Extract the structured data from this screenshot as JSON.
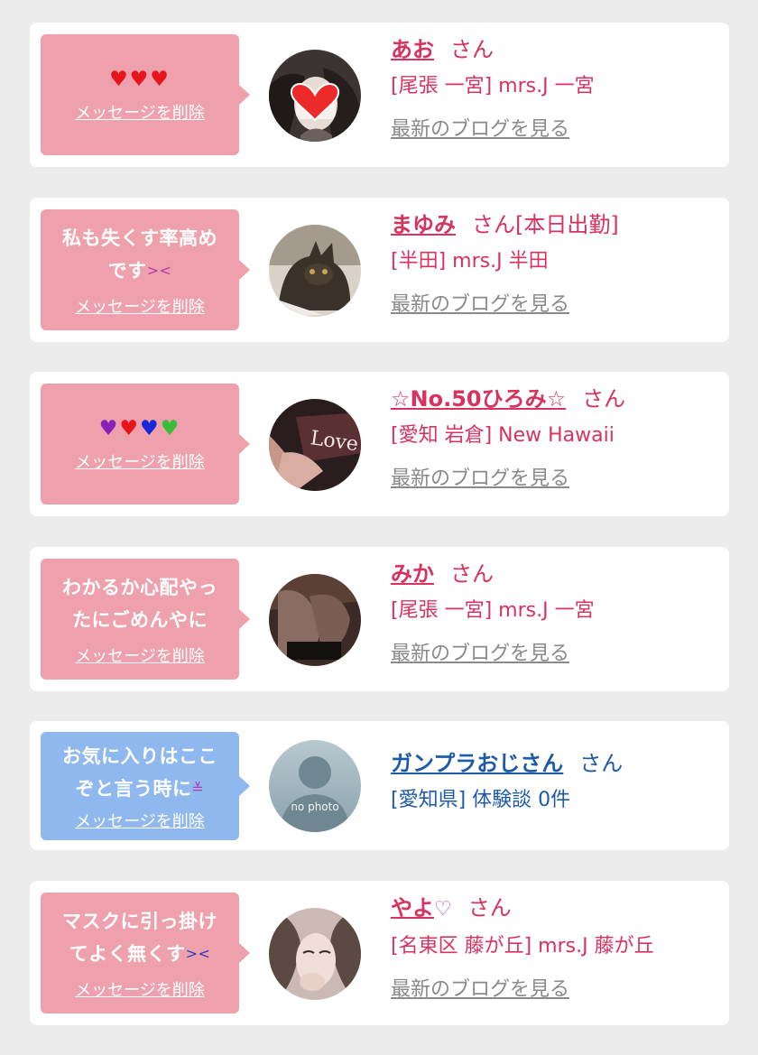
{
  "cards": [
    {
      "message_hearts": "♥♥♥",
      "delete_label": "メッセージを削除",
      "name": "あお",
      "honorific": "さん",
      "shop": "[尾張 一宮] mrs.J 一宮",
      "blog_link": "最新のブログを見る"
    },
    {
      "message_line1": "私も失くす率高め",
      "message_line2": "です",
      "delete_label": "メッセージを削除",
      "name": "まゆみ",
      "honorific": "さん[本日出勤]",
      "shop": "[半田] mrs.J 半田",
      "blog_link": "最新のブログを見る"
    },
    {
      "message_hearts": [
        "♥",
        "♥",
        "♥",
        "♥"
      ],
      "delete_label": "メッセージを削除",
      "name": "☆No.50ひろみ☆",
      "honorific": "さん",
      "shop": "[愛知 岩倉] New Hawaii",
      "blog_link": "最新のブログを見る"
    },
    {
      "message_line1": "わかるか心配やっ",
      "message_line2": "たにごめんやに",
      "delete_label": "メッセージを削除",
      "name": "みか",
      "honorific": "さん",
      "shop": "[尾張 一宮] mrs.J 一宮",
      "blog_link": "最新のブログを見る"
    },
    {
      "message_line1": "お気に入りはここ",
      "message_line2": "ぞと言う時に",
      "delete_label": "メッセージを削除",
      "name": "ガンプラおじさん",
      "honorific": "さん",
      "shop": "[愛知県] 体験談 0件",
      "avatar_text": "no photo"
    },
    {
      "message_line1": "マスクに引っ掛け",
      "message_line2": "てよく無くす",
      "delete_label": "メッセージを削除",
      "name": "やよ",
      "honorific": "さん",
      "shop": "[名東区 藤が丘] mrs.J 藤が丘",
      "blog_link": "最新のブログを見る"
    }
  ],
  "colors": {
    "bubble_pink": "#eea1ac",
    "bubble_blue": "#8fb8ee",
    "text_pink": "#d8325f",
    "text_blue": "#1d5aa8",
    "link_gray": "#8a8a8a",
    "background": "#ececec"
  }
}
